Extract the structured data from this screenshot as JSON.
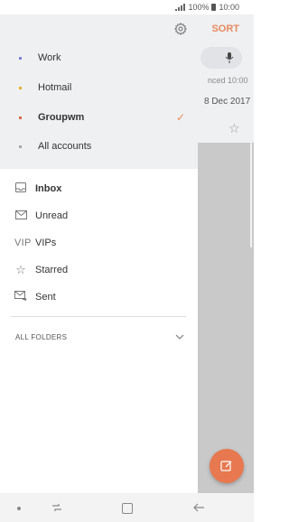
{
  "status_bar": {
    "battery_text": "100%",
    "time": "10:00"
  },
  "background_view": {
    "sort_partial": "T",
    "sort_label": "SORT",
    "email_line1": "nced 10:00",
    "email_line2": "8 Dec 2017"
  },
  "drawer": {
    "accounts": [
      {
        "label": "Work",
        "dot_color": "#7b7fdc",
        "selected": false,
        "bold": false
      },
      {
        "label": "Hotmail",
        "dot_color": "#e8b12e",
        "selected": false,
        "bold": false
      },
      {
        "label": "Groupwm",
        "dot_color": "#e06a4d",
        "selected": true,
        "bold": true
      },
      {
        "label": "All accounts",
        "dot_color": "#a7a7a7",
        "selected": false,
        "bold": false
      }
    ],
    "folders": [
      {
        "label": "Inbox",
        "icon": "inbox-icon",
        "bold": true
      },
      {
        "label": "Unread",
        "icon": "envelope-icon",
        "bold": false
      },
      {
        "label": "VIPs",
        "icon_text": "VIP",
        "icon": "vip-icon",
        "bold": false
      },
      {
        "label": "Starred",
        "icon": "star-icon",
        "bold": false
      },
      {
        "label": "Sent",
        "icon": "sent-icon",
        "bold": false
      }
    ],
    "all_folders_label": "ALL FOLDERS"
  },
  "colors": {
    "accent": "#ea8a5f",
    "fab": "#e8784f",
    "drawer_header_bg": "#eef0f2"
  }
}
